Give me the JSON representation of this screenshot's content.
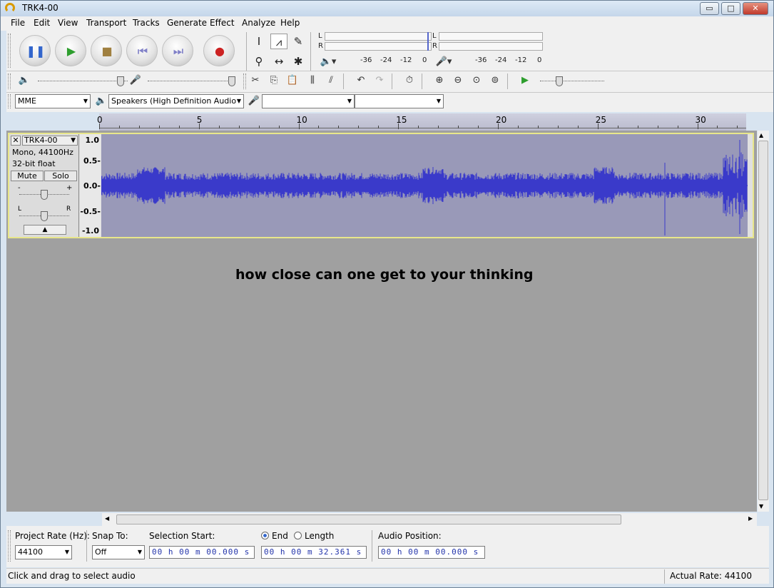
{
  "window": {
    "title": "TRK4-00",
    "minimize": "▭",
    "maximize": "□",
    "close": "✕"
  },
  "menu": [
    "File",
    "Edit",
    "View",
    "Transport",
    "Tracks",
    "Generate",
    "Effect",
    "Analyze",
    "Help"
  ],
  "transport": {
    "buttons": [
      {
        "name": "pause-button",
        "glyph": "❚❚",
        "color": "#3366cc"
      },
      {
        "name": "play-button",
        "glyph": "▶",
        "color": "#2e9e2e"
      },
      {
        "name": "stop-button",
        "glyph": "■",
        "color": "#a08040"
      },
      {
        "name": "skip-start-button",
        "glyph": "⏮",
        "color": "#8080c8"
      },
      {
        "name": "skip-end-button",
        "glyph": "⏭",
        "color": "#8080c8"
      },
      {
        "name": "record-button",
        "glyph": "●",
        "color": "#cc2222"
      }
    ]
  },
  "meters": {
    "playback": {
      "l": "L",
      "r": "R"
    },
    "record": {
      "l": "L",
      "r": "R"
    },
    "scale": [
      "-36",
      "-24",
      "-12",
      "0"
    ]
  },
  "device": {
    "host": "MME",
    "output": "Speakers (High Definition Audio",
    "input": "",
    "channels": ""
  },
  "ruler": {
    "ticks": [
      "0",
      "5",
      "10",
      "15",
      "20",
      "25",
      "30"
    ]
  },
  "track": {
    "name": "TRK4-00",
    "info1": "Mono, 44100Hz",
    "info2": "32-bit float",
    "mute": "Mute",
    "solo": "Solo",
    "gain_minus": "-",
    "gain_plus": "+",
    "pan_l": "L",
    "pan_r": "R",
    "scale": [
      "1.0",
      "0.5-",
      "0.0-",
      "-0.5-",
      "-1.0"
    ],
    "wave_color": "#3a3aca"
  },
  "caption": "how close can one get to your thinking",
  "selection": {
    "project_rate_label": "Project Rate (Hz):",
    "project_rate": "44100",
    "snap_label": "Snap To:",
    "snap": "Off",
    "start_label": "Selection Start:",
    "end_label": "End",
    "length_label": "Length",
    "position_label": "Audio Position:",
    "start": "00 h 00 m 00.000 s",
    "end": "00 h 00 m 32.361 s",
    "position": "00 h 00 m 00.000 s"
  },
  "status": {
    "hint": "Click and drag to select audio",
    "rate": "Actual Rate: 44100"
  }
}
